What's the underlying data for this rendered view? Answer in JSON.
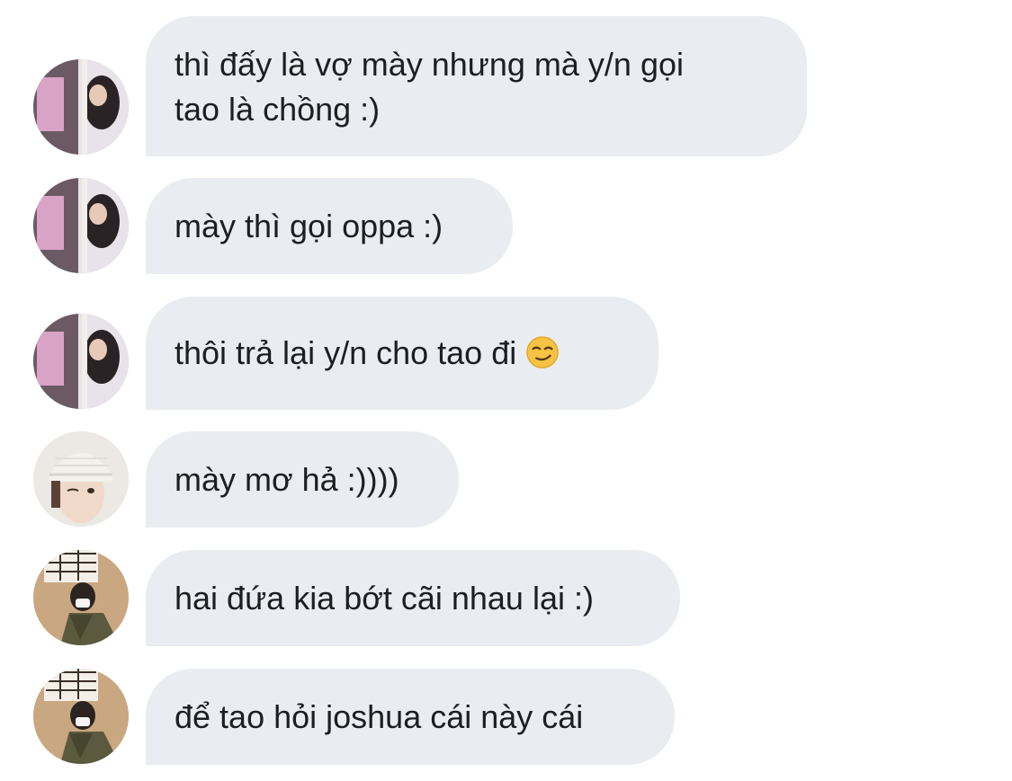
{
  "conversation": {
    "messages": [
      {
        "sender_avatar": "girl-collage-avatar",
        "text": "thì đấy là vợ mày nhưng mà y/n gọi\ntao là chồng :)"
      },
      {
        "sender_avatar": "girl-collage-avatar",
        "text": "mày thì gọi oppa :)"
      },
      {
        "sender_avatar": "girl-collage-avatar",
        "text": "thôi trả lại y/n cho tao đi",
        "emoji": "smirking-face-emoji"
      },
      {
        "sender_avatar": "beanie-boy-avatar",
        "text": "mày mơ hả :))))"
      },
      {
        "sender_avatar": "masked-boy-avatar",
        "text": "hai đứa kia bớt cãi nhau lại :)"
      },
      {
        "sender_avatar": "masked-boy-avatar",
        "text": "để tao hỏi joshua cái này cái"
      }
    ]
  },
  "colors": {
    "bubble_bg": "#e9edf1",
    "text": "#1c1e21",
    "background": "#ffffff"
  }
}
